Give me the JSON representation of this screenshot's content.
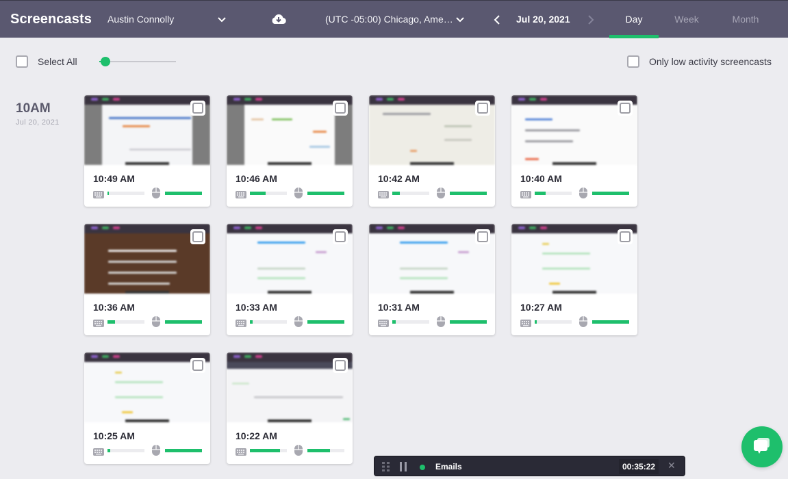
{
  "header": {
    "title": "Screencasts",
    "user": "Austin Connolly",
    "timezone": "(UTC -05:00) Chicago, Ame…",
    "date": "Jul 20, 2021",
    "download_icon": "cloud-download-icon",
    "tabs": [
      {
        "label": "Day",
        "active": true
      },
      {
        "label": "Week",
        "active": false
      },
      {
        "label": "Month",
        "active": false
      }
    ]
  },
  "toolbar": {
    "select_all_label": "Select All",
    "select_all_checked": false,
    "zoom_slider_value": 0.08,
    "low_activity_label": "Only low activity screencasts",
    "low_activity_checked": false
  },
  "groups": [
    {
      "hour": "10AM",
      "date": "Jul 20, 2021",
      "screencasts": [
        {
          "time": "10:49 AM",
          "keyboard": 0.04,
          "mouse": 1.0,
          "theme": "web-blue"
        },
        {
          "time": "10:46 AM",
          "keyboard": 0.42,
          "mouse": 1.0,
          "theme": "web-profile"
        },
        {
          "time": "10:42 AM",
          "keyboard": 0.2,
          "mouse": 1.0,
          "theme": "doc-form"
        },
        {
          "time": "10:40 AM",
          "keyboard": 0.3,
          "mouse": 1.0,
          "theme": "doc-list"
        },
        {
          "time": "10:36 AM",
          "keyboard": 0.2,
          "mouse": 1.0,
          "theme": "web-dark"
        },
        {
          "time": "10:33 AM",
          "keyboard": 0.07,
          "mouse": 1.0,
          "theme": "email"
        },
        {
          "time": "10:31 AM",
          "keyboard": 0.1,
          "mouse": 1.0,
          "theme": "email"
        },
        {
          "time": "10:27 AM",
          "keyboard": 0.05,
          "mouse": 1.0,
          "theme": "email-yellow"
        },
        {
          "time": "10:25 AM",
          "keyboard": 0.08,
          "mouse": 1.0,
          "theme": "email-yellow"
        },
        {
          "time": "10:22 AM",
          "keyboard": 0.82,
          "mouse": 0.62,
          "theme": "app-dark"
        }
      ]
    }
  ],
  "tracker": {
    "project": "Emails",
    "timer": "00:35:22",
    "status": "running"
  },
  "colors": {
    "accent": "#1ebf6c",
    "header_bg": "#5a5870",
    "page_bg": "#ececf0"
  }
}
